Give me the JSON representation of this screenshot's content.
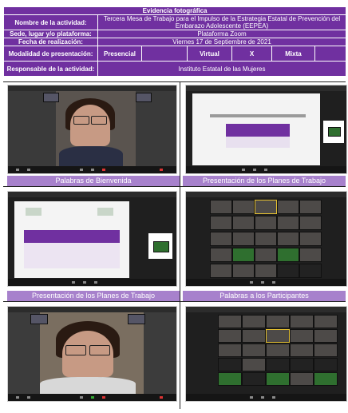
{
  "header": {
    "title": "Evidencia fotográfica"
  },
  "info": {
    "activity_label": "Nombre de la actividad:",
    "activity_value": "Tercera Mesa de Trabajo para el Impulso de la Estrategia Estatal de Prevención del Embarazo Adolescente (EEPEA)",
    "venue_label": "Sede, lugar y/o plataforma:",
    "venue_value": "Plataforma Zoom",
    "date_label": "Fecha de realización:",
    "date_value": "Viernes 17 de Septiembre de 2021",
    "modality_label": "Modalidad de presentación:",
    "modality_options": {
      "presencial": "Presencial",
      "virtual": "Virtual",
      "mark": "X",
      "mixta": "Mixta"
    },
    "responsible_label": "Responsable de la actividad:",
    "responsible_value": "Instituto Estatal de las Mujeres"
  },
  "captions": {
    "c1": "Palabras de Bienvenida",
    "c2": "Presentación de los Planes de Trabajo",
    "c3": "Presentación de los Planes de Trabajo",
    "c4": "Palabras a los Participantes"
  },
  "colors": {
    "header_purple": "#7030a0",
    "caption_lavender": "#a781cc"
  },
  "photos": [
    {
      "id": "p1",
      "kind": "zoom-speaker-view"
    },
    {
      "id": "p2",
      "kind": "zoom-shared-document"
    },
    {
      "id": "p3",
      "kind": "zoom-shared-document"
    },
    {
      "id": "p4",
      "kind": "zoom-gallery-view"
    },
    {
      "id": "p5",
      "kind": "zoom-speaker-view"
    },
    {
      "id": "p6",
      "kind": "zoom-gallery-view"
    }
  ]
}
